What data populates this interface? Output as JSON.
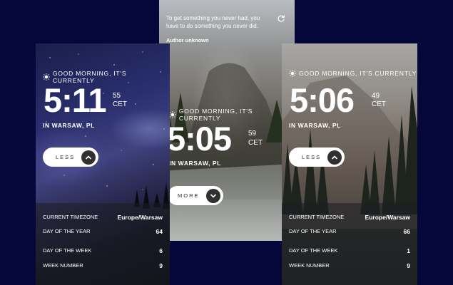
{
  "center": {
    "quote": "To get something you never had, you have to do something you never did.",
    "author": "Author unknown",
    "greeting": "GOOD MORNING, IT'S CURRENTLY",
    "time": "5:05",
    "seconds": "59",
    "zone": "CET",
    "location": "IN WARSAW, PL",
    "toggle_label": "MORE"
  },
  "left": {
    "greeting": "GOOD MORNING, IT'S CURRENTLY",
    "time": "5:11",
    "seconds": "55",
    "zone": "CET",
    "location": "IN WARSAW, PL",
    "toggle_label": "LESS",
    "details": [
      {
        "label": "CURRENT TIMEZONE",
        "value": "Europe/Warsaw"
      },
      {
        "label": "DAY OF THE YEAR",
        "value": "64"
      },
      {
        "label": "DAY OF THE WEEK",
        "value": "6"
      },
      {
        "label": "WEEK NUMBER",
        "value": "9"
      }
    ]
  },
  "right": {
    "greeting": "GOOD MORNING, IT'S CURRENTLY",
    "time": "5:06",
    "seconds": "49",
    "zone": "CET",
    "location": "IN WARSAW, PL",
    "toggle_label": "LESS",
    "details": [
      {
        "label": "CURRENT TIMEZONE",
        "value": "Europe/Warsaw"
      },
      {
        "label": "DAY OF THE YEAR",
        "value": "66"
      },
      {
        "label": "DAY OF THE WEEK",
        "value": "1"
      },
      {
        "label": "WEEK NUMBER",
        "value": "9"
      }
    ]
  },
  "icons": {
    "sun": "sun-icon",
    "refresh": "refresh-icon",
    "chevron_up": "chevron-up-icon",
    "chevron_down": "chevron-down-icon"
  },
  "colors": {
    "page_background": "#05073a",
    "toggle_background": "#ffffff",
    "toggle_knob": "#303030"
  }
}
